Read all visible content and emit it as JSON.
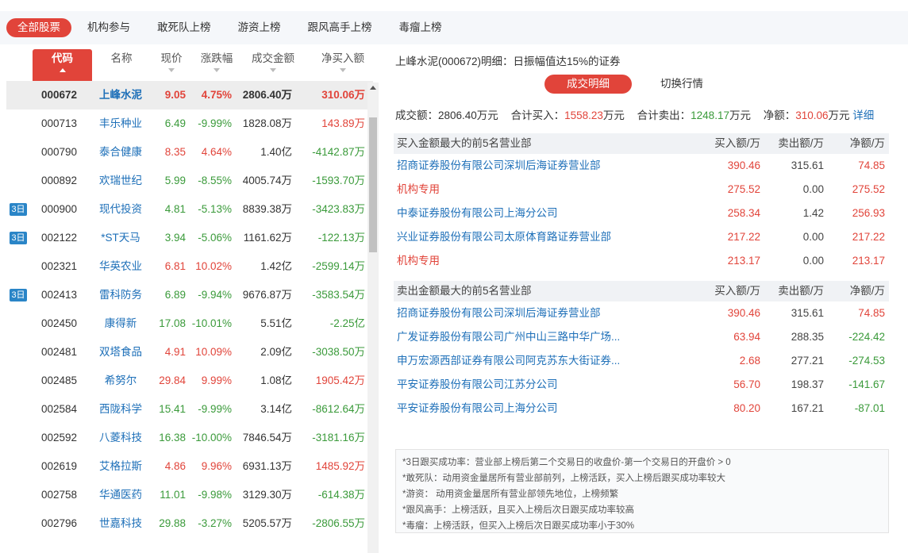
{
  "tabs": [
    "全部股票",
    "机构参与",
    "敢死队上榜",
    "游资上榜",
    "跟风高手上榜",
    "毒瘤上榜"
  ],
  "table": {
    "headers": {
      "code": "代码",
      "name": "名称",
      "price": "现价",
      "change": "涨跌幅",
      "amount": "成交金额",
      "net": "净买入额"
    },
    "rows": [
      {
        "badge": "",
        "code": "000672",
        "name": "上峰水泥",
        "price": "9.05",
        "change": "4.75%",
        "amount": "2806.40万",
        "net": "310.06万",
        "dir": "red",
        "netdir": "red",
        "selected": true
      },
      {
        "badge": "",
        "code": "000713",
        "name": "丰乐种业",
        "price": "6.49",
        "change": "-9.99%",
        "amount": "1828.08万",
        "net": "143.89万",
        "dir": "green",
        "netdir": "red"
      },
      {
        "badge": "",
        "code": "000790",
        "name": "泰合健康",
        "price": "8.35",
        "change": "4.64%",
        "amount": "1.40亿",
        "net": "-4142.87万",
        "dir": "red",
        "netdir": "green"
      },
      {
        "badge": "",
        "code": "000892",
        "name": "欢瑞世纪",
        "price": "5.99",
        "change": "-8.55%",
        "amount": "4005.74万",
        "net": "-1593.70万",
        "dir": "green",
        "netdir": "green"
      },
      {
        "badge": "3日",
        "code": "000900",
        "name": "现代投资",
        "price": "4.81",
        "change": "-5.13%",
        "amount": "8839.38万",
        "net": "-3423.83万",
        "dir": "green",
        "netdir": "green"
      },
      {
        "badge": "3日",
        "code": "002122",
        "name": "*ST天马",
        "price": "3.94",
        "change": "-5.06%",
        "amount": "1161.62万",
        "net": "-122.13万",
        "dir": "green",
        "netdir": "green"
      },
      {
        "badge": "",
        "code": "002321",
        "name": "华英农业",
        "price": "6.81",
        "change": "10.02%",
        "amount": "1.42亿",
        "net": "-2599.14万",
        "dir": "red",
        "netdir": "green"
      },
      {
        "badge": "3日",
        "code": "002413",
        "name": "雷科防务",
        "price": "6.89",
        "change": "-9.94%",
        "amount": "9676.87万",
        "net": "-3583.54万",
        "dir": "green",
        "netdir": "green"
      },
      {
        "badge": "",
        "code": "002450",
        "name": "康得新",
        "price": "17.08",
        "change": "-10.01%",
        "amount": "5.51亿",
        "net": "-2.25亿",
        "dir": "green",
        "netdir": "green"
      },
      {
        "badge": "",
        "code": "002481",
        "name": "双塔食品",
        "price": "4.91",
        "change": "10.09%",
        "amount": "2.09亿",
        "net": "-3038.50万",
        "dir": "red",
        "netdir": "green"
      },
      {
        "badge": "",
        "code": "002485",
        "name": "希努尔",
        "price": "29.84",
        "change": "9.99%",
        "amount": "1.08亿",
        "net": "1905.42万",
        "dir": "red",
        "netdir": "red"
      },
      {
        "badge": "",
        "code": "002584",
        "name": "西陇科学",
        "price": "15.41",
        "change": "-9.99%",
        "amount": "3.14亿",
        "net": "-8612.64万",
        "dir": "green",
        "netdir": "green"
      },
      {
        "badge": "",
        "code": "002592",
        "name": "八菱科技",
        "price": "16.38",
        "change": "-10.00%",
        "amount": "7846.54万",
        "net": "-3181.16万",
        "dir": "green",
        "netdir": "green"
      },
      {
        "badge": "",
        "code": "002619",
        "name": "艾格拉斯",
        "price": "4.86",
        "change": "9.96%",
        "amount": "6931.13万",
        "net": "1485.92万",
        "dir": "red",
        "netdir": "red"
      },
      {
        "badge": "",
        "code": "002758",
        "name": "华通医药",
        "price": "11.01",
        "change": "-9.98%",
        "amount": "3129.30万",
        "net": "-614.38万",
        "dir": "green",
        "netdir": "green"
      },
      {
        "badge": "",
        "code": "002796",
        "name": "世嘉科技",
        "price": "29.88",
        "change": "-3.27%",
        "amount": "5205.57万",
        "net": "-2806.55万",
        "dir": "green",
        "netdir": "green"
      }
    ]
  },
  "detail": {
    "title": "上峰水泥(000672)明细：日振幅值达15%的证券",
    "subtabs": [
      "成交明细",
      "切换行情"
    ],
    "summary": {
      "amount_label": "成交额：",
      "amount_value": "2806.40万元",
      "buy_label": "合计买入：",
      "buy_value": "1558.23",
      "buy_unit": "万元",
      "sell_label": "合计卖出：",
      "sell_value": "1248.17",
      "sell_unit": "万元",
      "net_label": "净额：",
      "net_value": "310.06",
      "net_unit": "万元",
      "link": "详细"
    },
    "buy_block": {
      "title": "买入金额最大的前5名营业部",
      "cols": [
        "买入额/万",
        "卖出额/万",
        "净额/万"
      ],
      "rows": [
        {
          "name": "招商证券股份有限公司深圳后海证券营业部",
          "buy": "390.46",
          "sell": "315.61",
          "net": "74.85",
          "namecolor": "blue",
          "netcolor": "red"
        },
        {
          "name": "机构专用",
          "buy": "275.52",
          "sell": "0.00",
          "net": "275.52",
          "namecolor": "red",
          "netcolor": "red"
        },
        {
          "name": "中泰证券股份有限公司上海分公司",
          "buy": "258.34",
          "sell": "1.42",
          "net": "256.93",
          "namecolor": "blue",
          "netcolor": "red"
        },
        {
          "name": "兴业证券股份有限公司太原体育路证券营业部",
          "buy": "217.22",
          "sell": "0.00",
          "net": "217.22",
          "namecolor": "blue",
          "netcolor": "red"
        },
        {
          "name": "机构专用",
          "buy": "213.17",
          "sell": "0.00",
          "net": "213.17",
          "namecolor": "red",
          "netcolor": "red"
        }
      ]
    },
    "sell_block": {
      "title": "卖出金额最大的前5名营业部",
      "cols": [
        "买入额/万",
        "卖出额/万",
        "净额/万"
      ],
      "rows": [
        {
          "name": "招商证券股份有限公司深圳后海证券营业部",
          "buy": "390.46",
          "sell": "315.61",
          "net": "74.85",
          "namecolor": "blue",
          "netcolor": "red"
        },
        {
          "name": "广发证券股份有限公司广州中山三路中华广场...",
          "buy": "63.94",
          "sell": "288.35",
          "net": "-224.42",
          "namecolor": "blue",
          "netcolor": "green"
        },
        {
          "name": "申万宏源西部证券有限公司阿克苏东大街证券...",
          "buy": "2.68",
          "sell": "277.21",
          "net": "-274.53",
          "namecolor": "blue",
          "netcolor": "green"
        },
        {
          "name": "平安证券股份有限公司江苏分公司",
          "buy": "56.70",
          "sell": "198.37",
          "net": "-141.67",
          "namecolor": "blue",
          "netcolor": "green"
        },
        {
          "name": "平安证券股份有限公司上海分公司",
          "buy": "80.20",
          "sell": "167.21",
          "net": "-87.01",
          "namecolor": "blue",
          "netcolor": "green"
        }
      ]
    },
    "notes": [
      "*3日跟买成功率：营业部上榜后第二个交易日的收盘价-第一个交易日的开盘价 > 0",
      "*敢死队：动用资金量居所有营业部前列，上榜活跃，买入上榜后跟买成功率较大",
      "*游资：  动用资金量居所有营业部领先地位，上榜频繁",
      "*跟风高手：上榜活跃，且买入上榜后次日跟买成功率较高",
      "*毒瘤：上榜活跃，但买入上榜后次日跟买成功率小于30%"
    ]
  },
  "colors": {
    "accent": "#e1443a",
    "up": "#e1443a",
    "down": "#3a9a3a",
    "link": "#1d6fb8",
    "badge": "#2a85c7"
  },
  "icons": {
    "sort": "triangle-sort-icon",
    "scroll_up": "scroll-up-arrow-icon",
    "scroll_down": "scroll-down-arrow-icon"
  }
}
